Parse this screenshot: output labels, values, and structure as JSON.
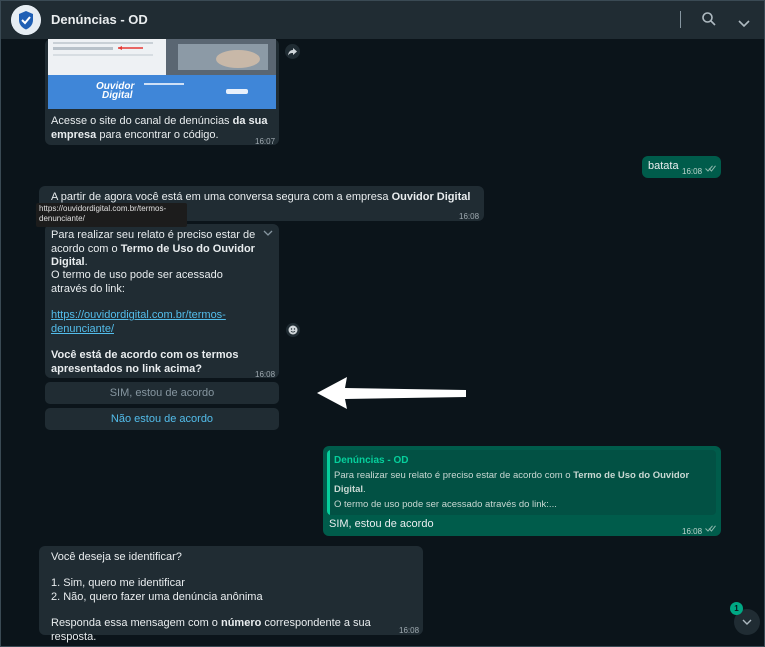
{
  "header": {
    "title": "Denúncias - OD",
    "avatar_icon": "shield-logo-icon",
    "search_icon": "search-icon",
    "menu_icon": "chevron-down-icon"
  },
  "image_message": {
    "caption_pre": "Acesse o site do canal de denúncias ",
    "caption_bold1": "da sua",
    "caption_bold2": "empresa",
    "caption_post": " para encontrar o código.",
    "time": "16:07",
    "image_logo_line1": "Ouvidor",
    "image_logo_line2": "Digital"
  },
  "batata_message": {
    "text": "batata",
    "time": "16:08"
  },
  "secure_message": {
    "text_pre": "A partir de agora você está em uma conversa segura com a empresa ",
    "text_bold": "Ouvidor Digital -",
    "time": "16:08"
  },
  "tooltip": {
    "text": "https://ouvidordigital.com.br/termos-denunciante/"
  },
  "terms_message": {
    "line1_pre": "Para realizar seu relato é preciso estar de acordo com o ",
    "line1_bold": "Termo de Uso do Ouvidor Digital",
    "line1_post": ".",
    "line2": "O termo de uso pode ser acessado através do link:",
    "link": "https://ouvidordigital.com.br/termos-denunciante/",
    "question": "Você está de acordo com os termos apresentados no link acima?",
    "time": "16:08"
  },
  "quick_replies": [
    {
      "label": "SIM, estou de acordo"
    },
    {
      "label": "Não estou de acordo"
    }
  ],
  "reply_message": {
    "quote_author": "Denúncias - OD",
    "quote_line1_pre": "Para realizar seu relato é preciso estar de acordo com o ",
    "quote_line1_bold": "Termo de Uso do Ouvidor Digital",
    "quote_line1_post": ".",
    "quote_line2": "O termo de uso pode ser acessado através do link:...",
    "text": "SIM, estou de acordo",
    "time": "16:08"
  },
  "ident_message": {
    "question": "Você deseja se identificar?",
    "option1": "1. Sim, quero me identificar",
    "option2": "2. Não, quero fazer uma denúncia anônima",
    "instr_pre": "Responda essa mensagem com o ",
    "instr_bold": "número",
    "instr_post": " correspondente a sua resposta.",
    "time": "16:08"
  },
  "scroll": {
    "unread_count": "1"
  }
}
